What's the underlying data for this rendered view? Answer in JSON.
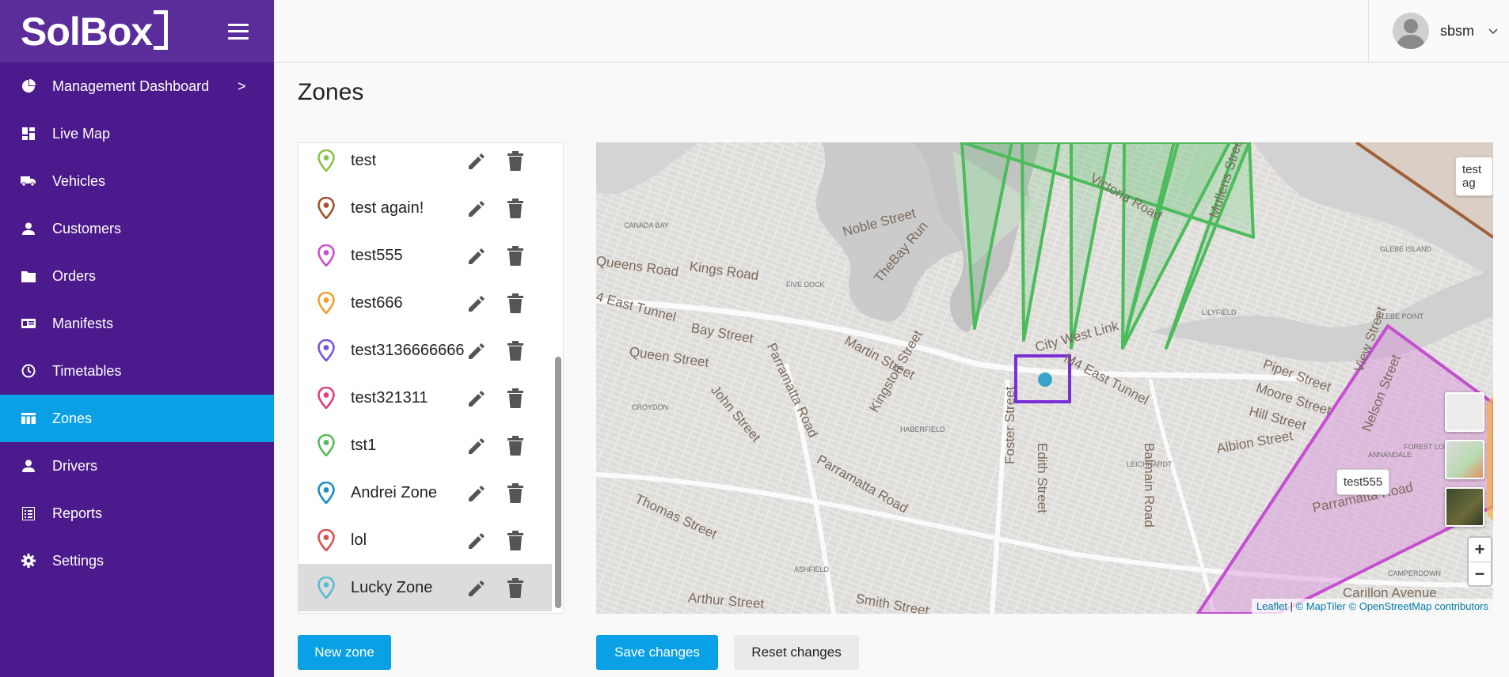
{
  "app": {
    "logo": "SolBox"
  },
  "sidebar": {
    "items": [
      {
        "label": "Management Dashboard",
        "icon": "pie-chart-icon",
        "has_submenu": true,
        "active": false
      },
      {
        "label": "Live Map",
        "icon": "dashboard-grid-icon",
        "active": false
      },
      {
        "label": "Vehicles",
        "icon": "truck-icon",
        "active": false
      },
      {
        "label": "Customers",
        "icon": "person-icon",
        "active": false
      },
      {
        "label": "Orders",
        "icon": "folder-icon",
        "active": false
      },
      {
        "label": "Manifests",
        "icon": "id-card-icon",
        "active": false
      },
      {
        "label": "Timetables",
        "icon": "clock-icon",
        "active": false
      },
      {
        "label": "Zones",
        "icon": "table-icon",
        "active": true
      },
      {
        "label": "Drivers",
        "icon": "person-icon",
        "active": false
      },
      {
        "label": "Reports",
        "icon": "list-icon",
        "active": false
      },
      {
        "label": "Settings",
        "icon": "gear-icon",
        "active": false
      }
    ],
    "submenu_glyph": ">"
  },
  "header": {
    "username": "sbsm"
  },
  "page": {
    "title": "Zones"
  },
  "zones": [
    {
      "name": "test",
      "color": "#8bc34a"
    },
    {
      "name": "test again!",
      "color": "#a0522d"
    },
    {
      "name": "test555",
      "color": "#cc4fcc"
    },
    {
      "name": "test666",
      "color": "#f0a030"
    },
    {
      "name": "test3136666666",
      "color": "#7a55d8"
    },
    {
      "name": "test321311",
      "color": "#e0407a"
    },
    {
      "name": "tst1",
      "color": "#5cb85c"
    },
    {
      "name": "Andrei Zone",
      "color": "#1a8fc0"
    },
    {
      "name": "lol",
      "color": "#d9534f"
    },
    {
      "name": "Lucky Zone",
      "color": "#5bbcd0",
      "selected": true
    }
  ],
  "buttons": {
    "new_zone": "New zone",
    "save_changes": "Save changes",
    "reset_changes": "Reset changes"
  },
  "map": {
    "tooltips": [
      "test ag",
      "test555"
    ],
    "zoom_in": "+",
    "zoom_out": "−",
    "attribution": {
      "leaflet": "Leaflet",
      "sep": " | ",
      "maptiler": "© MapTiler",
      "osm": "© OpenStreetMap contributors"
    },
    "streets": [
      "Noble Street",
      "Victoria Road",
      "Mullens Street",
      "Queens Road",
      "Kings Road",
      "TheBay Run",
      "4 East Tunnel",
      "Bay Street",
      "Queen Street",
      "Martin Street",
      "Kingston Street",
      "City West Link",
      "M4 East Tunnel",
      "Piper Street",
      "Moore Street",
      "Hill Street",
      "View Street",
      "Nelson Street",
      "Parramatta Road",
      "John Street",
      "Parramatta Road",
      "Foster Street",
      "Edith Street",
      "Balmain Road",
      "Thomas Street",
      "Parramatta Road",
      "Albion Street",
      "Arthur Street",
      "Smith Street",
      "Carillon Avenue"
    ],
    "place_labels": [
      "CANADA BAY",
      "FIVE DOCK",
      "GLEBE ISLAND",
      "GLEBE POINT",
      "LILYFIELD",
      "CROYDON",
      "HABERFIELD",
      "LEICHHARDT",
      "ANNANDALE",
      "FOREST LODGE",
      "ASHFIELD",
      "CAMPERDOWN"
    ],
    "colors": {
      "green": "#4cbb5c",
      "magenta": "#c54fcf",
      "brown": "#a0603a",
      "highlight": "#7a2fd6",
      "marker": "#3aa3c9"
    }
  }
}
